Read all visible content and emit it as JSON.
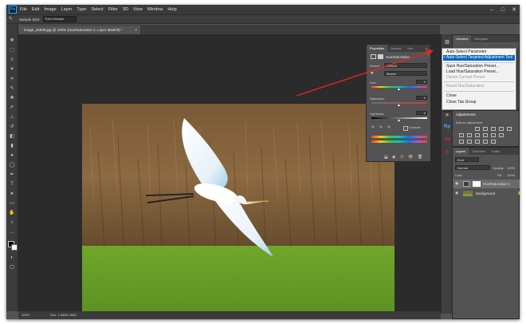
{
  "menubar": {
    "logo": "Ps",
    "items": [
      "File",
      "Edit",
      "Image",
      "Layer",
      "Type",
      "Select",
      "Filter",
      "3D",
      "View",
      "Window",
      "Help"
    ]
  },
  "options_bar": {
    "sample_size_label": "Sample Size:",
    "sample_size_value": "Point Sample"
  },
  "document": {
    "tab_title": "image_34939.jpg @ 100% (Hue/Saturation 1, Layer Mask/8) *",
    "status_zoom": "100%",
    "status_doc": "Doc: 1.69M/1.69M"
  },
  "properties_panel": {
    "tabs": [
      "Properties",
      "Actions",
      "Info"
    ],
    "title": "Hue/Saturation",
    "preset_label": "Preset:",
    "preset_value": "Default",
    "channel_value": "Master",
    "hue_label": "Hue:",
    "hue_value": "0",
    "saturation_label": "Saturation:",
    "saturation_value": "0",
    "lightness_label": "Lightness:",
    "lightness_value": "0",
    "colorize_label": "Colorize"
  },
  "libraries_panel": {
    "tabs": [
      "Libraries",
      "Navigator"
    ]
  },
  "flyout_menu": {
    "items": [
      {
        "label": "Auto-Select Parameter",
        "disabled": false,
        "checked": false
      },
      {
        "label": "Auto-Select Targeted Adjustment Tool",
        "disabled": false,
        "checked": true
      },
      {
        "label": "Save Hue/Saturation Preset...",
        "disabled": false,
        "checked": false
      },
      {
        "label": "Load Hue/Saturation Preset...",
        "disabled": false,
        "checked": false
      },
      {
        "label": "Delete Current Preset",
        "disabled": true,
        "checked": false
      },
      {
        "label": "Reset Hue/Saturation",
        "disabled": true,
        "checked": false
      },
      {
        "label": "Close",
        "disabled": false,
        "checked": false
      },
      {
        "label": "Close Tab Group",
        "disabled": false,
        "checked": false
      }
    ],
    "highlight_color": "#0b62c4"
  },
  "adjustments_panel": {
    "title": "Adjustments",
    "subtitle": "Add an adjustment"
  },
  "layers_panel": {
    "tabs": [
      "Layers",
      "Channels",
      "Paths"
    ],
    "kind_label": "Kind",
    "blend_mode": "Normal",
    "opacity_label": "Opacity:",
    "opacity_value": "100%",
    "lock_label": "Lock:",
    "fill_label": "Fill:",
    "fill_value": "100%",
    "layers": [
      {
        "name": "Hue/Saturation 1"
      },
      {
        "name": "Background"
      }
    ]
  },
  "side_strip": {
    "icons": [
      "library-icon",
      "adjustments-icon",
      "rp-plugin-icon",
      "im-plugin-icon",
      "color-wheel-icon"
    ],
    "labels": [
      "",
      "",
      "Rp",
      "im",
      ""
    ]
  },
  "colors": {
    "accent_arrow": "#e0281e",
    "menu_highlight": "#0b62c4"
  }
}
